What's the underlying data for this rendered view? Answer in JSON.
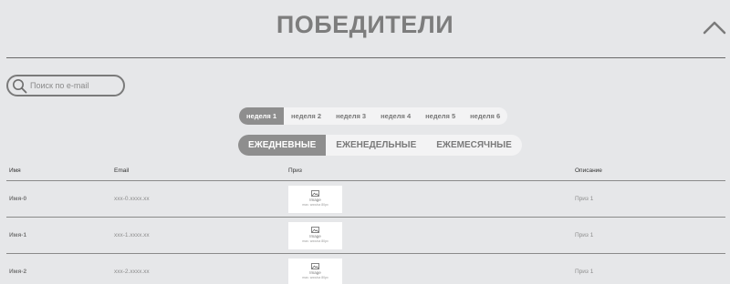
{
  "header": {
    "title": "ПОБЕДИТЕЛИ",
    "collapse_icon": "chevron-up-icon"
  },
  "search": {
    "placeholder": "Поиск по e-mail",
    "value": "",
    "icon": "search-icon"
  },
  "weeks": [
    {
      "label": "неделя 1",
      "active": true
    },
    {
      "label": "неделя 2",
      "active": false
    },
    {
      "label": "неделя 3",
      "active": false
    },
    {
      "label": "неделя 4",
      "active": false
    },
    {
      "label": "неделя 5",
      "active": false
    },
    {
      "label": "неделя 6",
      "active": false
    }
  ],
  "periods": [
    {
      "label": "ЕЖЕДНЕВНЫЕ",
      "active": true
    },
    {
      "label": "ЕЖЕНЕДЕЛЬНЫЕ",
      "active": false
    },
    {
      "label": "ЕЖЕМЕСЯЧНЫЕ",
      "active": false
    }
  ],
  "table": {
    "columns": {
      "name": "Имя",
      "email": "Email",
      "prize": "Приз",
      "description": "Описание"
    },
    "rows": [
      {
        "name": "Имя-0",
        "email": "xxx-0.xxxx.xx",
        "image_label": "Image",
        "image_size": "max. wwx/ca 80px",
        "description": "Приз 1"
      },
      {
        "name": "Имя-1",
        "email": "xxx-1.xxxx.xx",
        "image_label": "Image",
        "image_size": "max. wwx/ca 80px",
        "description": "Приз 1"
      },
      {
        "name": "Имя-2",
        "email": "xxx-2.xxxx.xx",
        "image_label": "Image",
        "image_size": "max. wwx/ca 80px",
        "description": "Приз 1"
      }
    ]
  },
  "colors": {
    "background": "#e6e7e9",
    "active_tab": "#8e8e8e",
    "title": "#7d7d7d"
  }
}
